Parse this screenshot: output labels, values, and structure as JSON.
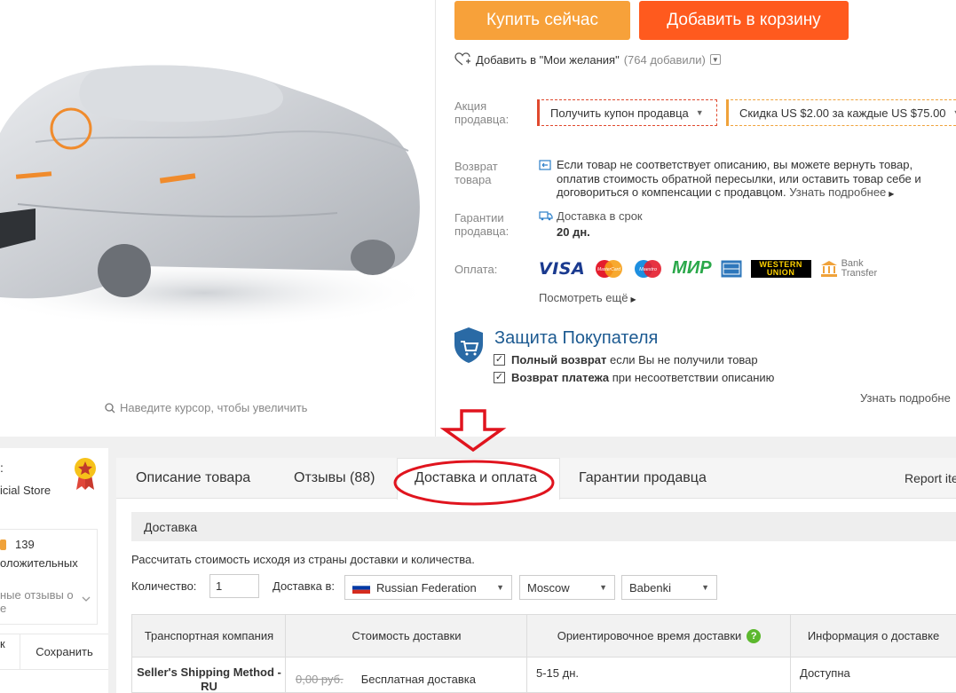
{
  "product": {
    "zoom_hint": "Наведите курсор, чтобы увеличить"
  },
  "actions": {
    "buy_now": "Купить сейчас",
    "add_to_cart": "Добавить в корзину",
    "wishlist_label": "Добавить в \"Мои желания\"",
    "wishlist_count": "(764 добавили)"
  },
  "promo": {
    "label": "Акция продавца:",
    "coupon_button": "Получить купон продавца",
    "discount_prefix": "Скидка",
    "discount_amount": "US $2.00",
    "discount_middle": "за каждые",
    "discount_threshold": "US $75.00"
  },
  "returns": {
    "label": "Возврат товара",
    "text": "Если товар не соответствует описанию, вы можете вернуть товар, оплатив стоимость обратной пересылки, или оставить товар себе и договориться о компенсации с продавцом.",
    "more": "Узнать подробнее"
  },
  "guarantee": {
    "label": "Гарантии продавца:",
    "delivery_on_time": "Доставка в срок",
    "days": "20 дн."
  },
  "payment": {
    "label": "Оплата:",
    "methods": [
      "VISA",
      "MasterCard",
      "Maestro",
      "МИР",
      "American Express",
      "WESTERN UNION",
      "Bank Transfer"
    ],
    "see_more": "Посмотреть ещё"
  },
  "buyer_protection": {
    "title": "Защита Покупателя",
    "line1_bold": "Полный возврат",
    "line1_rest": "если Вы не получили товар",
    "line2_bold": "Возврат платежа",
    "line2_rest": "при несоответствии описанию",
    "more": "Узнать подробне"
  },
  "store": {
    "name_fragment": "icial Store",
    "colon": ":",
    "count": "139",
    "positive_fragment": "оложительных",
    "reviews_fragment_1": "ные отзывы о",
    "reviews_fragment_2": "е",
    "left_button_fragment": "к",
    "save_button": "Сохранить"
  },
  "tabs": [
    {
      "label": "Описание товара"
    },
    {
      "label": "Отзывы (88)"
    },
    {
      "label": "Доставка и оплата"
    },
    {
      "label": "Гарантии продавца"
    },
    {
      "label": "Report ite"
    }
  ],
  "shipping": {
    "section_title": "Доставка",
    "calc_text": "Рассчитать стоимость исходя из страны доставки и количества.",
    "quantity_label": "Количество:",
    "quantity_value": "1",
    "ship_to_label": "Доставка в:",
    "country": "Russian Federation",
    "region": "Moscow",
    "city": "Babenki",
    "table": {
      "headers": [
        "Транспортная компания",
        "Стоимость доставки",
        "Ориентировочное время доставки",
        "Информация о доставке"
      ],
      "rows": [
        {
          "company": "Seller's Shipping Method - RU",
          "old_price": "0,00 руб.",
          "price": "Бесплатная доставка",
          "time": "5-15 дн.",
          "info": "Доступна"
        }
      ]
    }
  },
  "colors": {
    "buy_now": "#f7a13a",
    "add_to_cart": "#ff5a1e",
    "protection_blue": "#1c5a91",
    "annotation_red": "#e0141e"
  }
}
